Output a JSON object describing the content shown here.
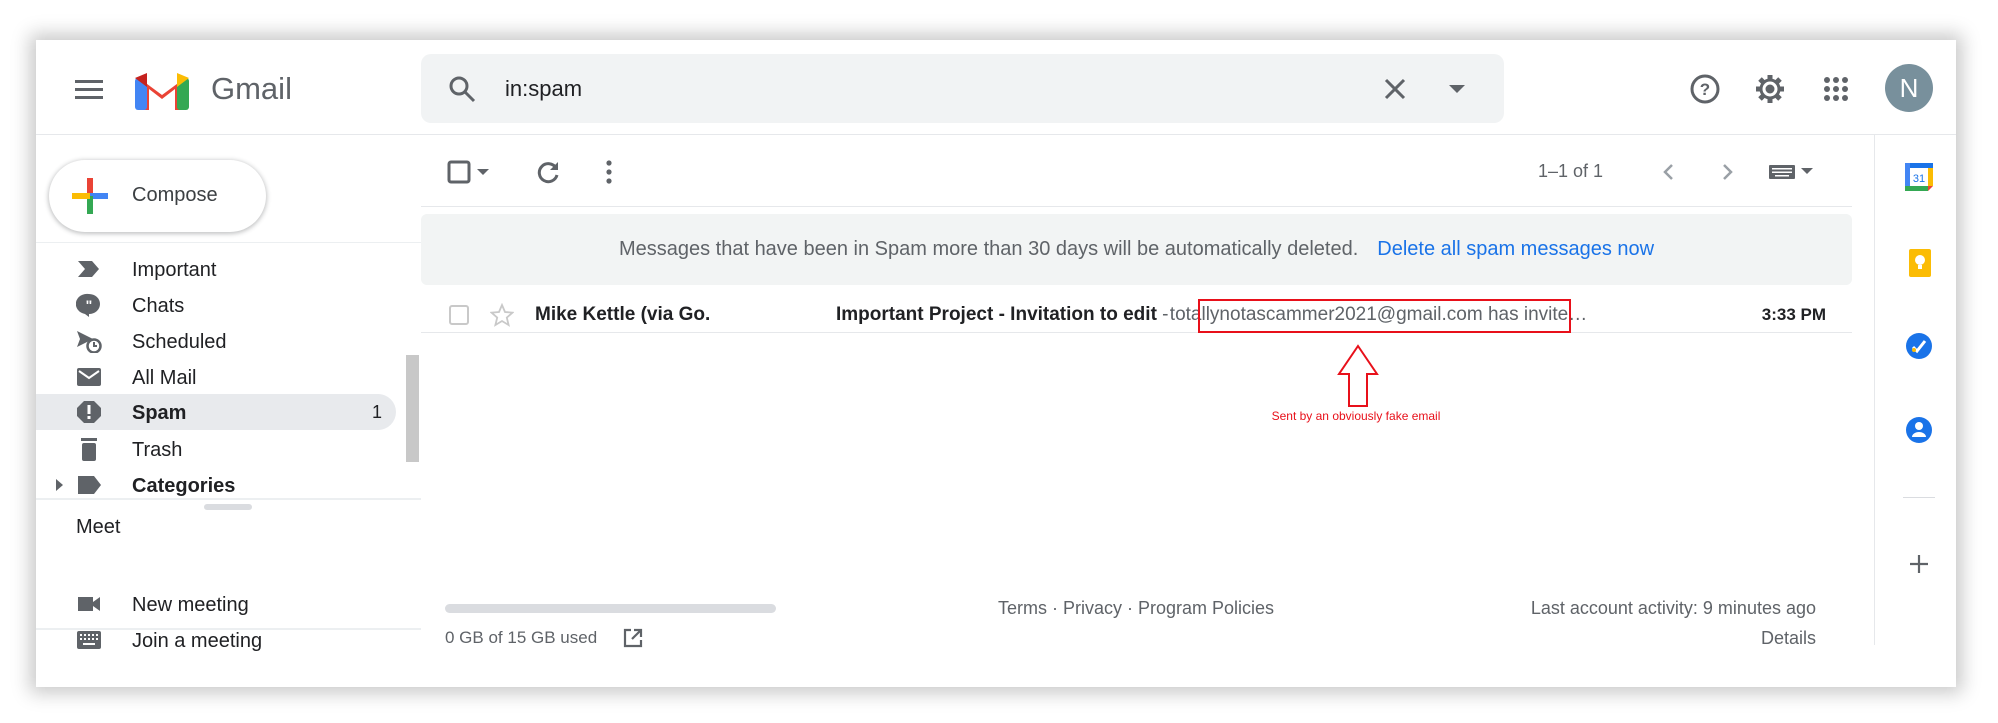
{
  "header": {
    "app_name": "Gmail",
    "search_value": "in:spam",
    "avatar_letter": "N"
  },
  "compose_label": "Compose",
  "sidebar": {
    "items": [
      {
        "label": "Important",
        "icon": "important-icon"
      },
      {
        "label": "Chats",
        "icon": "chats-icon"
      },
      {
        "label": "Scheduled",
        "icon": "scheduled-icon"
      },
      {
        "label": "All Mail",
        "icon": "mail-icon"
      },
      {
        "label": "Spam",
        "icon": "spam-icon",
        "count": "1",
        "active": true
      },
      {
        "label": "Trash",
        "icon": "trash-icon"
      },
      {
        "label": "Categories",
        "icon": "label-icon"
      }
    ],
    "meet": {
      "title": "Meet",
      "items": [
        {
          "label": "New meeting",
          "icon": "video-icon"
        },
        {
          "label": "Join a meeting",
          "icon": "keyboard-icon"
        }
      ]
    }
  },
  "toolbar": {
    "pagination": "1–1 of 1"
  },
  "banner": {
    "text": "Messages that have been in Spam more than 30 days will be automatically deleted.",
    "link": "Delete all spam messages now"
  },
  "emails": [
    {
      "sender": "Mike Kettle (via Go.",
      "subject": "Important Project - Invitation to edit",
      "separator": " - ",
      "snippet_highlight": "totallynotascammer2021@gmail.com",
      "snippet_rest": " has invite…",
      "time": "3:33 PM"
    }
  ],
  "annotation": {
    "caption": "Sent by an obviously fake email",
    "color": "#e8101a"
  },
  "footer": {
    "storage": "0 GB of 15 GB used",
    "storage_fraction": 0,
    "links": "Terms · Privacy · Program Policies",
    "activity": "Last account activity: 9 minutes ago",
    "details": "Details"
  },
  "colors": {
    "link": "#1a73e8",
    "avatar": "#78909c",
    "active_bg": "#e8eaed"
  }
}
